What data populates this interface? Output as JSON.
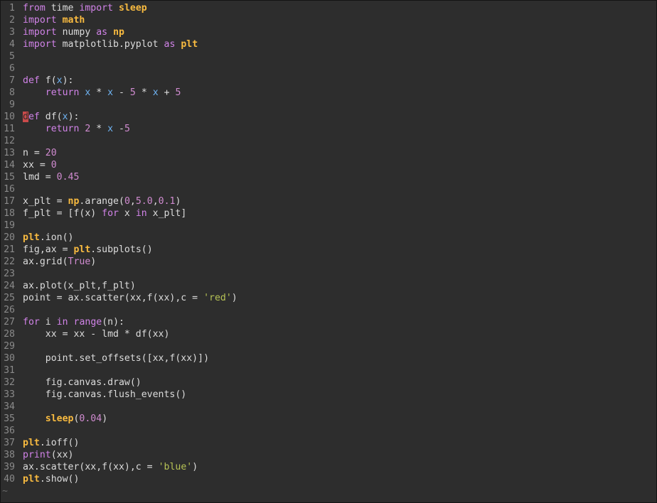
{
  "colors": {
    "background": "#2d2d2d",
    "keyword": "#d183e8",
    "module": "#f9bb40",
    "number": "#d08bd0",
    "variable": "#6fb3f2",
    "string": "#b6c255",
    "cursor": "#c94a4a"
  },
  "lines": [
    [
      [
        "kw",
        "from"
      ],
      [
        "t",
        " time "
      ],
      [
        "kw",
        "import"
      ],
      [
        "t",
        " "
      ],
      [
        "mod",
        "sleep"
      ]
    ],
    [
      [
        "kw",
        "import"
      ],
      [
        "t",
        " "
      ],
      [
        "mod",
        "math"
      ]
    ],
    [
      [
        "kw",
        "import"
      ],
      [
        "t",
        " numpy "
      ],
      [
        "kw",
        "as"
      ],
      [
        "t",
        " "
      ],
      [
        "mod",
        "np"
      ]
    ],
    [
      [
        "kw",
        "import"
      ],
      [
        "t",
        " matplotlib.pyplot "
      ],
      [
        "kw",
        "as"
      ],
      [
        "t",
        " "
      ],
      [
        "mod",
        "plt"
      ]
    ],
    [],
    [],
    [
      [
        "kw",
        "def"
      ],
      [
        "t",
        " f("
      ],
      [
        "var",
        "x"
      ],
      [
        "t",
        "):"
      ]
    ],
    [
      [
        "t",
        "    "
      ],
      [
        "kw",
        "return"
      ],
      [
        "t",
        " "
      ],
      [
        "var",
        "x"
      ],
      [
        "t",
        " * "
      ],
      [
        "var",
        "x"
      ],
      [
        "t",
        " - "
      ],
      [
        "num",
        "5"
      ],
      [
        "t",
        " * "
      ],
      [
        "var",
        "x"
      ],
      [
        "t",
        " + "
      ],
      [
        "num",
        "5"
      ]
    ],
    [],
    [
      [
        "cur",
        "d"
      ],
      [
        "kw",
        "ef"
      ],
      [
        "t",
        " df("
      ],
      [
        "var",
        "x"
      ],
      [
        "t",
        "):"
      ]
    ],
    [
      [
        "t",
        "    "
      ],
      [
        "kw",
        "return"
      ],
      [
        "t",
        " "
      ],
      [
        "num",
        "2"
      ],
      [
        "t",
        " * "
      ],
      [
        "var",
        "x"
      ],
      [
        "t",
        " -"
      ],
      [
        "num",
        "5"
      ]
    ],
    [],
    [
      [
        "t",
        "n = "
      ],
      [
        "num",
        "20"
      ]
    ],
    [
      [
        "t",
        "xx = "
      ],
      [
        "num",
        "0"
      ]
    ],
    [
      [
        "t",
        "lmd = "
      ],
      [
        "num",
        "0.45"
      ]
    ],
    [],
    [
      [
        "t",
        "x_plt = "
      ],
      [
        "mod",
        "np"
      ],
      [
        "t",
        ".arange("
      ],
      [
        "num",
        "0"
      ],
      [
        "t",
        ","
      ],
      [
        "num",
        "5.0"
      ],
      [
        "t",
        ","
      ],
      [
        "num",
        "0.1"
      ],
      [
        "t",
        ")"
      ]
    ],
    [
      [
        "t",
        "f_plt = [f(x) "
      ],
      [
        "kw",
        "for"
      ],
      [
        "t",
        " x "
      ],
      [
        "kw",
        "in"
      ],
      [
        "t",
        " x_plt]"
      ]
    ],
    [],
    [
      [
        "mod",
        "plt"
      ],
      [
        "t",
        ".ion()"
      ]
    ],
    [
      [
        "t",
        "fig,ax = "
      ],
      [
        "mod",
        "plt"
      ],
      [
        "t",
        ".subplots()"
      ]
    ],
    [
      [
        "t",
        "ax.grid("
      ],
      [
        "num",
        "True"
      ],
      [
        "t",
        ")"
      ]
    ],
    [],
    [
      [
        "t",
        "ax.plot(x_plt,f_plt)"
      ]
    ],
    [
      [
        "t",
        "point = ax.scatter(xx,f(xx),c = "
      ],
      [
        "str",
        "'red'"
      ],
      [
        "t",
        ")"
      ]
    ],
    [],
    [
      [
        "kw",
        "for"
      ],
      [
        "t",
        " i "
      ],
      [
        "kw",
        "in"
      ],
      [
        "t",
        " "
      ],
      [
        "kw",
        "range"
      ],
      [
        "t",
        "(n):"
      ]
    ],
    [
      [
        "t",
        "    xx = xx - lmd * df(xx)"
      ]
    ],
    [],
    [
      [
        "t",
        "    point.set_offsets([xx,f(xx)])"
      ]
    ],
    [],
    [
      [
        "t",
        "    fig.canvas.draw()"
      ]
    ],
    [
      [
        "t",
        "    fig.canvas.flush_events()"
      ]
    ],
    [],
    [
      [
        "t",
        "    "
      ],
      [
        "mod",
        "sleep"
      ],
      [
        "t",
        "("
      ],
      [
        "num",
        "0.04"
      ],
      [
        "t",
        ")"
      ]
    ],
    [],
    [
      [
        "mod",
        "plt"
      ],
      [
        "t",
        ".ioff()"
      ]
    ],
    [
      [
        "kw",
        "print"
      ],
      [
        "t",
        "(xx)"
      ]
    ],
    [
      [
        "t",
        "ax.scatter(xx,f(xx),c = "
      ],
      [
        "str",
        "'blue'"
      ],
      [
        "t",
        ")"
      ]
    ],
    [
      [
        "mod",
        "plt"
      ],
      [
        "t",
        ".show()"
      ]
    ]
  ],
  "line_numbers": [
    "1",
    "2",
    "3",
    "4",
    "5",
    "6",
    "7",
    "8",
    "9",
    "10",
    "11",
    "12",
    "13",
    "14",
    "15",
    "16",
    "17",
    "18",
    "19",
    "20",
    "21",
    "22",
    "23",
    "24",
    "25",
    "26",
    "27",
    "28",
    "29",
    "30",
    "31",
    "32",
    "33",
    "34",
    "35",
    "36",
    "37",
    "38",
    "39",
    "40"
  ],
  "tilde": "~"
}
